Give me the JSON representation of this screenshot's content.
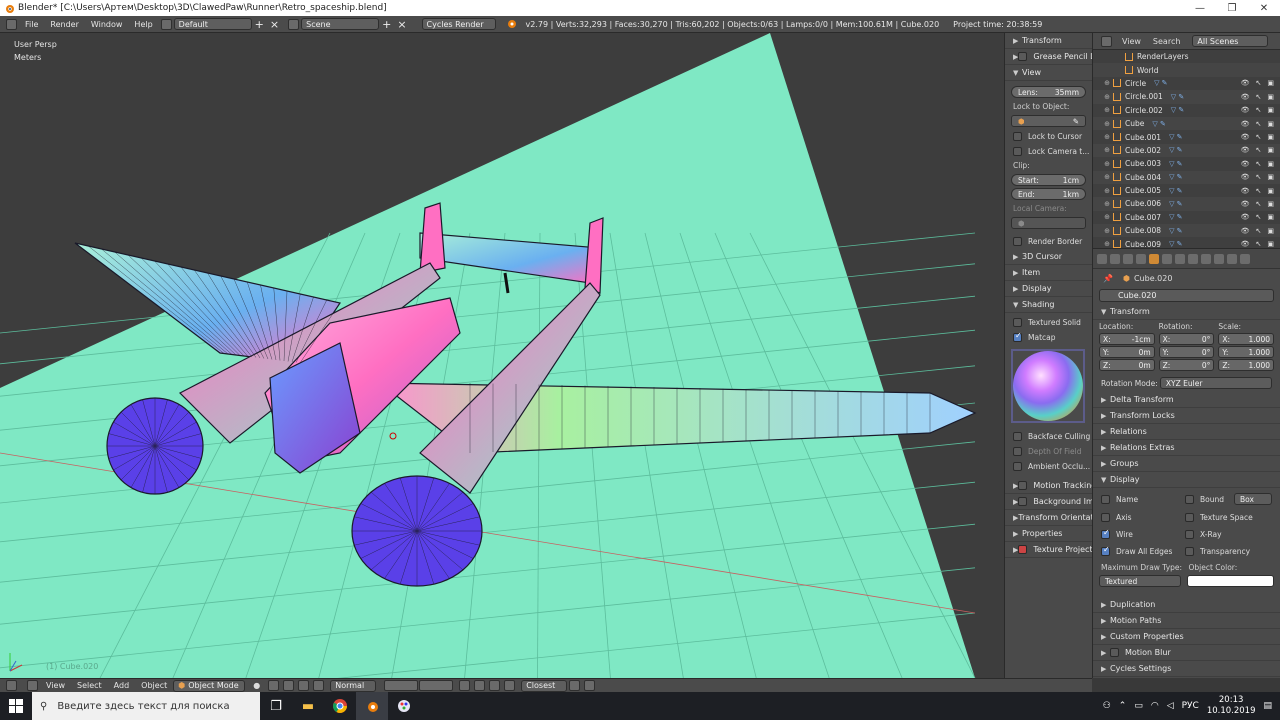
{
  "window": {
    "title": "Blender* [C:\\Users\\Артем\\Desktop\\3D\\ClawedPaw\\Runner\\Retro_spaceship.blend]",
    "controls": [
      "minimize",
      "maximize",
      "close"
    ]
  },
  "info_header": {
    "menus": [
      "File",
      "Render",
      "Window",
      "Help"
    ],
    "layout": "Default",
    "scene": "Scene",
    "engine": "Cycles Render",
    "stats": "v2.79 | Verts:32,293 | Faces:30,270 | Tris:60,202 | Objects:0/63 | Lamps:0/0 | Mem:100.61M | Cube.020",
    "project_time": "Project time: 20:38:59"
  },
  "viewport": {
    "view_name": "User Persp",
    "units": "Meters",
    "object_label": "(1) Cube.020",
    "floor_color": "#7fe8c4",
    "background_color": "#3d3d3d"
  },
  "n_panel": {
    "transform": "Transform",
    "grease_pencil": "Grease Pencil La",
    "view": "View",
    "lens_label": "Lens:",
    "lens_value": "35mm",
    "lock_to_object": "Lock to Object:",
    "lock_to_cursor": "Lock to Cursor",
    "lock_camera": "Lock Camera t...",
    "clip": "Clip:",
    "start_label": "Start:",
    "start_value": "1cm",
    "end_label": "End:",
    "end_value": "1km",
    "local_camera": "Local Camera:",
    "render_border": "Render Border",
    "cursor_3d": "3D Cursor",
    "item": "Item",
    "display": "Display",
    "shading": "Shading",
    "textured_solid": "Textured Solid",
    "matcap": "Matcap",
    "backface_culling": "Backface Culling",
    "depth_of_field": "Depth Of Field",
    "ambient_occlusion": "Ambient Occlu...",
    "motion_tracking": "Motion Tracking",
    "background_images": "Background Imag",
    "transform_orientations": "Transform Orientatio",
    "properties": "Properties",
    "texture_projection": "Texture Projectio"
  },
  "outliner": {
    "menus": [
      "View",
      "Search"
    ],
    "filter": "All Scenes",
    "items": [
      {
        "name": "RenderLayers",
        "indent": 2
      },
      {
        "name": "World",
        "indent": 2
      },
      {
        "name": "Circle",
        "indent": 1
      },
      {
        "name": "Circle.001",
        "indent": 1
      },
      {
        "name": "Circle.002",
        "indent": 1
      },
      {
        "name": "Cube",
        "indent": 1
      },
      {
        "name": "Cube.001",
        "indent": 1
      },
      {
        "name": "Cube.002",
        "indent": 1
      },
      {
        "name": "Cube.003",
        "indent": 1
      },
      {
        "name": "Cube.004",
        "indent": 1
      },
      {
        "name": "Cube.005",
        "indent": 1
      },
      {
        "name": "Cube.006",
        "indent": 1
      },
      {
        "name": "Cube.007",
        "indent": 1
      },
      {
        "name": "Cube.008",
        "indent": 1
      },
      {
        "name": "Cube.009",
        "indent": 1
      }
    ]
  },
  "properties": {
    "context_object": "Cube.020",
    "object_name": "Cube.020",
    "transform": "Transform",
    "location_label": "Location:",
    "rotation_label": "Rotation:",
    "scale_label": "Scale:",
    "location": [
      {
        "axis": "X:",
        "value": "-1cm"
      },
      {
        "axis": "Y:",
        "value": "0m"
      },
      {
        "axis": "Z:",
        "value": "0m"
      }
    ],
    "rotation": [
      {
        "axis": "X:",
        "value": "0°"
      },
      {
        "axis": "Y:",
        "value": "0°"
      },
      {
        "axis": "Z:",
        "value": "0°"
      }
    ],
    "scale": [
      {
        "axis": "X:",
        "value": "1.000"
      },
      {
        "axis": "Y:",
        "value": "1.000"
      },
      {
        "axis": "Z:",
        "value": "1.000"
      }
    ],
    "rotation_mode_label": "Rotation Mode:",
    "rotation_mode": "XYZ Euler",
    "delta_transform": "Delta Transform",
    "transform_locks": "Transform Locks",
    "relations": "Relations",
    "relations_extras": "Relations Extras",
    "groups": "Groups",
    "display": "Display",
    "name_chk": "Name",
    "bound_chk": "Bound",
    "bound_type": "Box",
    "axis_chk": "Axis",
    "texture_space_chk": "Texture Space",
    "wire_chk": "Wire",
    "xray_chk": "X-Ray",
    "draw_all_edges_chk": "Draw All Edges",
    "transparency_chk": "Transparency",
    "max_draw_type_label": "Maximum Draw Type:",
    "max_draw_type": "Textured",
    "object_color_label": "Object Color:",
    "duplication": "Duplication",
    "motion_paths": "Motion Paths",
    "custom_properties": "Custom Properties",
    "motion_blur": "Motion Blur",
    "cycles_settings": "Cycles Settings"
  },
  "view3d_header": {
    "menus": [
      "View",
      "Select",
      "Add",
      "Object"
    ],
    "mode": "Object Mode",
    "pivot": "Normal",
    "snap": "Closest"
  },
  "taskbar": {
    "search_placeholder": "Введите здесь текст для поиска",
    "language": "РУС",
    "time": "20:13",
    "date": "10.10.2019"
  }
}
